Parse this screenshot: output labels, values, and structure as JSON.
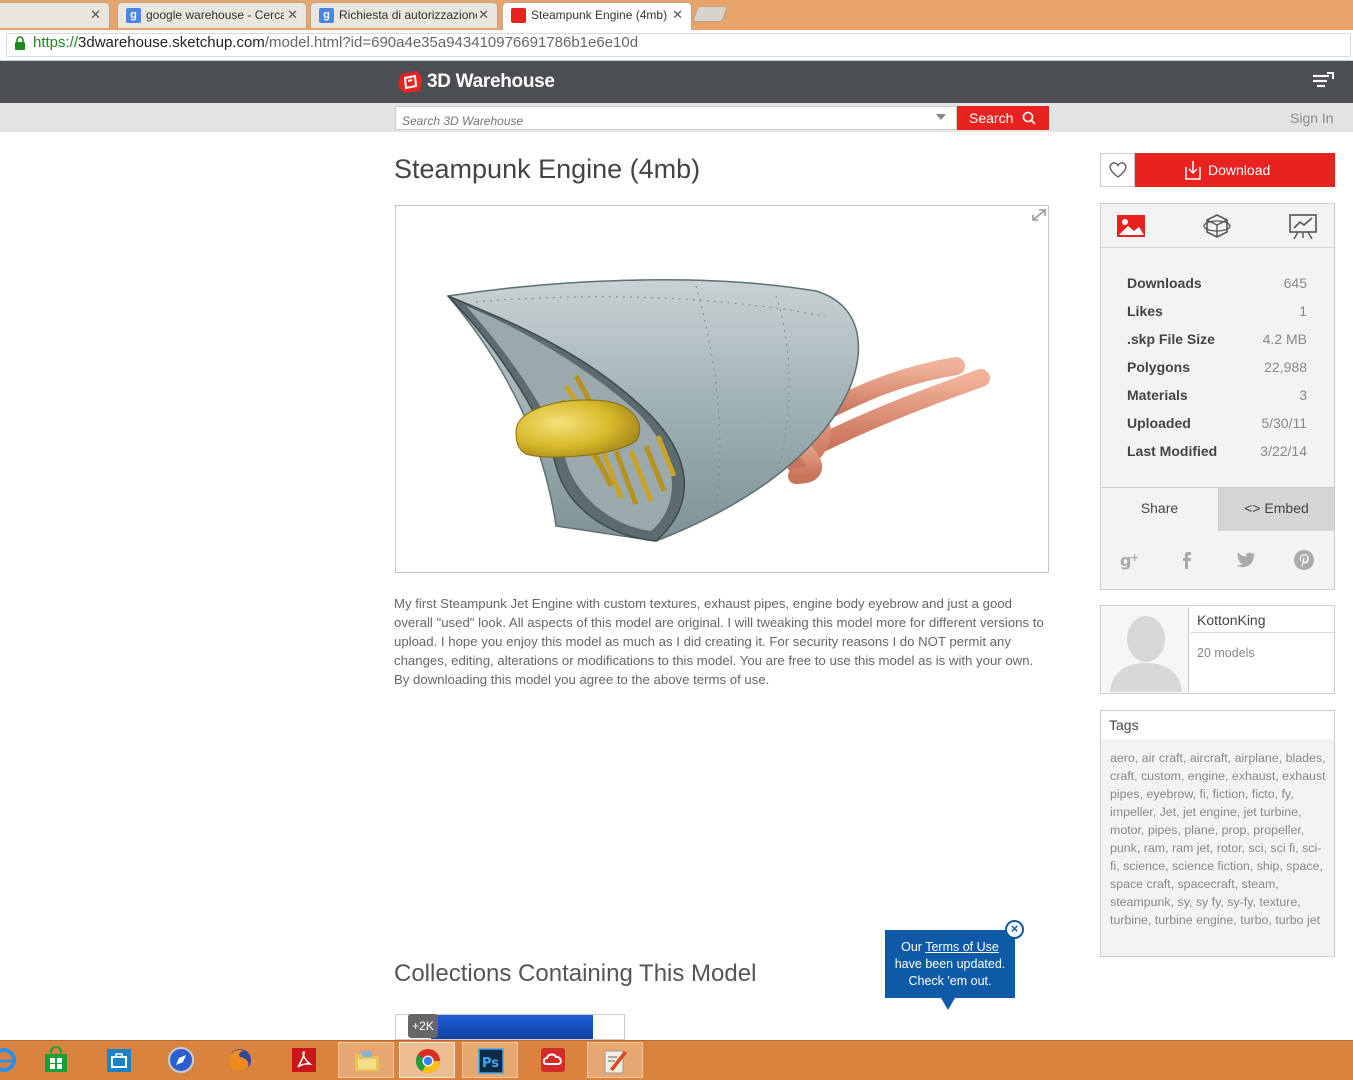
{
  "browser": {
    "tabs": [
      {
        "label": "",
        "active": false
      },
      {
        "label": "google warehouse - Cerca",
        "active": false
      },
      {
        "label": "Richiesta di autorizzazione",
        "active": false
      },
      {
        "label": "Steampunk Engine (4mb)",
        "active": true
      }
    ],
    "url": {
      "scheme": "https://",
      "host": "3dwarehouse.sketchup.com",
      "path": "/model.html?id=690a4e35a943410976691786b1e6e10d"
    }
  },
  "site": {
    "logo_text": "3D Warehouse",
    "search_placeholder": "Search 3D Warehouse",
    "search_button": "Search",
    "sign_in": "Sign In",
    "accent_color": "#e8231f"
  },
  "model": {
    "title": "Steampunk Engine (4mb)",
    "description": "My first Steampunk Jet Engine with custom textures, exhaust pipes, engine body eyebrow and just a good overall \"used\" look. All aspects of this model are original. I will tweaking this model more for different versions to upload. I hope you enjoy this model as much as I did creating it. For security reasons I do NOT permit any changes, editing, alterations or modifications to this model. You are free to use this model as is with your own. By downloading this model you agree to the above terms of use.",
    "collections_title": "Collections Containing This Model",
    "collection_count": "+2K"
  },
  "sidebar": {
    "download_label": "Download",
    "stats": [
      {
        "label": "Downloads",
        "value": "645"
      },
      {
        "label": "Likes",
        "value": "1"
      },
      {
        "label": ".skp File Size",
        "value": "4.2 MB"
      },
      {
        "label": "Polygons",
        "value": "22,988"
      },
      {
        "label": "Materials",
        "value": "3"
      },
      {
        "label": "Uploaded",
        "value": "5/30/11"
      },
      {
        "label": "Last Modified",
        "value": "3/22/14"
      }
    ],
    "share_tab": "Share",
    "embed_tab": "<> Embed",
    "social_icons": [
      "google-plus-icon",
      "facebook-icon",
      "twitter-icon",
      "pinterest-icon"
    ],
    "author": {
      "name": "KottonKing",
      "models": "20 models"
    },
    "tags_title": "Tags",
    "tags": "aero, air craft, aircraft, airplane, blades, craft, custom, engine, exhaust, exhaust pipes, eyebrow, fi, fiction, ficto, fy, impeller, Jet, jet engine, jet turbine, motor, pipes, plane, prop, propeller, punk, ram, ram jet, rotor, sci, sci fi, sci-fi, science, science fiction, ship, space, space craft, spacecraft, steam, steampunk, sy, sy fy, sy-fy, texture, turbine, turbine engine, turbo, turbo jet"
  },
  "terms_notice": {
    "line1_prefix": "Our ",
    "link": "Terms of Use",
    "line2": "have been updated.",
    "line3": "Check 'em out."
  },
  "taskbar": {
    "items": [
      "ie-icon",
      "store-icon",
      "briefcase-icon",
      "safari-icon",
      "firefox-icon",
      "acrobat-icon",
      "file-explorer-icon",
      "chrome-icon",
      "photoshop-icon",
      "creative-cloud-icon",
      "sketchup-icon"
    ]
  }
}
